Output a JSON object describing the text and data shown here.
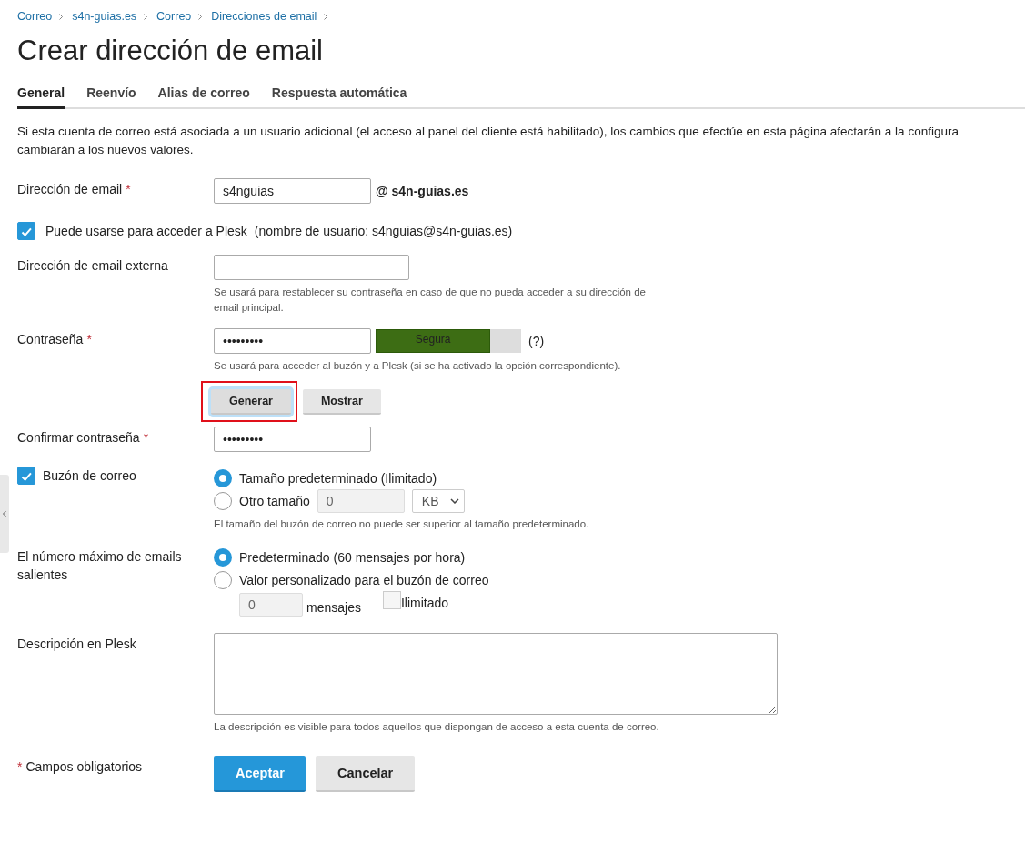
{
  "breadcrumbs": [
    "Correo",
    "s4n-guias.es",
    "Correo",
    "Direcciones de email"
  ],
  "title": "Crear dirección de email",
  "tabs": [
    {
      "label": "General",
      "selected": true
    },
    {
      "label": "Reenvío",
      "selected": false
    },
    {
      "label": "Alias de correo",
      "selected": false
    },
    {
      "label": "Respuesta automática",
      "selected": false
    }
  ],
  "intro_lines": [
    "Si esta cuenta de correo está asociada a un usuario adicional (el acceso al panel del cliente está habilitado), los cambios que efectúe en esta página afectarán a la configura",
    "cambiarán a los nuevos valores."
  ],
  "email": {
    "label": "Dirección de email",
    "mark": "*",
    "value": "s4nguias",
    "domain": "@ s4n-guias.es"
  },
  "plesk_access": {
    "label": "Puede usarse para acceder a Plesk",
    "note": "(nombre de usuario: s4nguias@s4n-guias.es)",
    "checked": true
  },
  "external_email": {
    "label": "Dirección de email externa",
    "hint": "Se usará para restablecer su contraseña en caso de que no pueda acceder a su dirección de email principal."
  },
  "password": {
    "label": "Contraseña",
    "mark": "*",
    "value": "•••••••••",
    "strength": {
      "label": "Segura",
      "level": 0.79
    },
    "help": "(?)",
    "hint": "Se usará para acceder al buzón y a Plesk (si se ha activado la opción correspondiente).",
    "buttons": [
      {
        "label": "Generar",
        "highlighted": true
      },
      {
        "label": "Mostrar",
        "highlighted": false
      }
    ]
  },
  "confirm_password": {
    "label": "Confirmar contraseña",
    "mark": "*",
    "value": "•••••••••"
  },
  "mailbox": {
    "label": "Buzón de correo",
    "checked": true,
    "options": [
      {
        "label": "Tamaño predeterminado (Ilimitado)",
        "selected": true
      },
      {
        "label": "Otro tamaño",
        "selected": false
      }
    ],
    "size_value": "0",
    "size_unit": "KB",
    "hint": "El tamaño del buzón de correo no puede ser superior al tamaño predeterminado."
  },
  "outgoing": {
    "label": "El número máximo de emails salientes",
    "options": [
      {
        "label": "Predeterminado (60 mensajes por hora)",
        "selected": true
      },
      {
        "label": "Valor personalizado para el buzón de correo",
        "selected": false
      }
    ],
    "custom_value": "0",
    "custom_unit": "mensajes",
    "unlimited": {
      "label": "Ilimitado",
      "checked": false
    }
  },
  "description": {
    "label": "Descripción en Plesk",
    "hint": "La descripción es visible para todos aquellos que dispongan de acceso a esta cuenta de correo."
  },
  "required_note": {
    "mark": "*",
    "text": "Campos obligatorios"
  },
  "actions": [
    {
      "label": "Aceptar",
      "kind": "primary"
    },
    {
      "label": "Cancelar",
      "kind": "secondary"
    }
  ]
}
